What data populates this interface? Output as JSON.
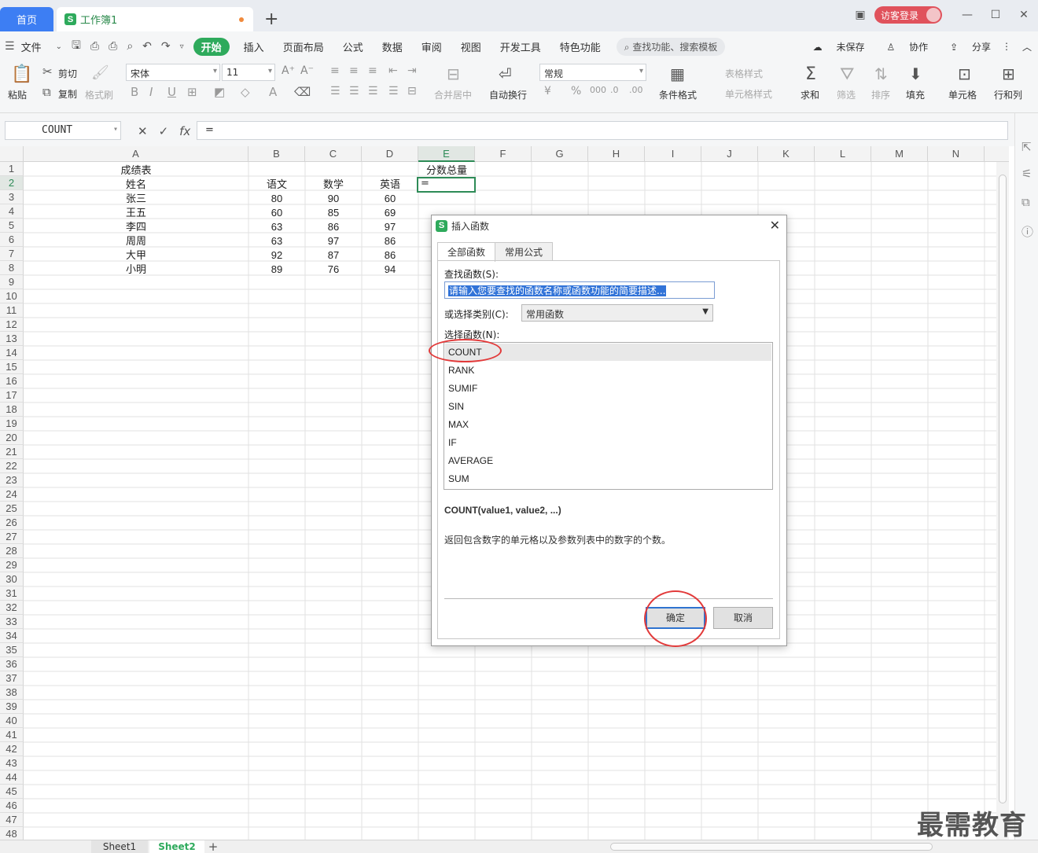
{
  "titlebar": {
    "home_tab": "首页",
    "doc_tab": "工作簿1",
    "add_tab": "+",
    "visitor_login": "访客登录",
    "minimize": "—",
    "maximize": "☐",
    "close": "✕"
  },
  "menubar": {
    "file": "文件",
    "items": [
      "开始",
      "插入",
      "页面布局",
      "公式",
      "数据",
      "审阅",
      "视图",
      "开发工具",
      "特色功能"
    ],
    "search": "查找功能、搜索模板",
    "unsaved": "未保存",
    "collab": "协作",
    "share": "分享"
  },
  "toolbar": {
    "paste": "粘贴",
    "cut": "剪切",
    "copy": "复制",
    "format_painter": "格式刷",
    "font_name": "宋体",
    "font_size": "11",
    "merge_center": "合并居中",
    "wrap_text": "自动换行",
    "number_format": "常规",
    "cond_format": "条件格式",
    "table_style": "表格样式",
    "cell_style": "单元格样式",
    "sum": "求和",
    "filter": "筛选",
    "sort": "排序",
    "fill": "填充",
    "cell": "单元格",
    "row_col": "行和列"
  },
  "formulabar": {
    "name_box": "COUNT",
    "formula": "="
  },
  "grid": {
    "columns": [
      "A",
      "B",
      "C",
      "D",
      "E",
      "F",
      "G",
      "H",
      "I",
      "J",
      "K",
      "L",
      "M",
      "N"
    ],
    "selected_column": "E",
    "selected_row": "2",
    "title_cell": "成绩表",
    "total_header": "分数总量",
    "active_cell_value": "=",
    "headers": [
      "姓名",
      "语文",
      "数学",
      "英语"
    ],
    "rows": [
      [
        "张三",
        "80",
        "90",
        "60"
      ],
      [
        "王五",
        "60",
        "85",
        "69"
      ],
      [
        "李四",
        "63",
        "86",
        "97"
      ],
      [
        "周周",
        "63",
        "97",
        "86"
      ],
      [
        "大甲",
        "92",
        "87",
        "86"
      ],
      [
        "小明",
        "89",
        "76",
        "94"
      ]
    ]
  },
  "sheets": {
    "tabs": [
      "Sheet1",
      "Sheet2"
    ],
    "active": "Sheet2",
    "add": "+"
  },
  "dialog": {
    "title": "插入函数",
    "close": "✕",
    "tabs": [
      "全部函数",
      "常用公式"
    ],
    "search_label": "查找函数(S):",
    "search_value": "请输入您要查找的函数名称或函数功能的简要描述...",
    "category_label": "或选择类别(C):",
    "category_value": "常用函数",
    "select_label": "选择函数(N):",
    "functions": [
      "COUNT",
      "RANK",
      "SUMIF",
      "SIN",
      "MAX",
      "IF",
      "AVERAGE",
      "SUM"
    ],
    "selected_function": "COUNT",
    "signature": "COUNT(value1, value2, ...)",
    "description": "返回包含数字的单元格以及参数列表中的数字的个数。",
    "ok": "确定",
    "cancel": "取消"
  },
  "watermark": "最需教育",
  "colors": {
    "accent_green": "#2eaa5c",
    "home_tab_blue": "#3d7ef3",
    "annotation_red": "#e23a3a"
  }
}
